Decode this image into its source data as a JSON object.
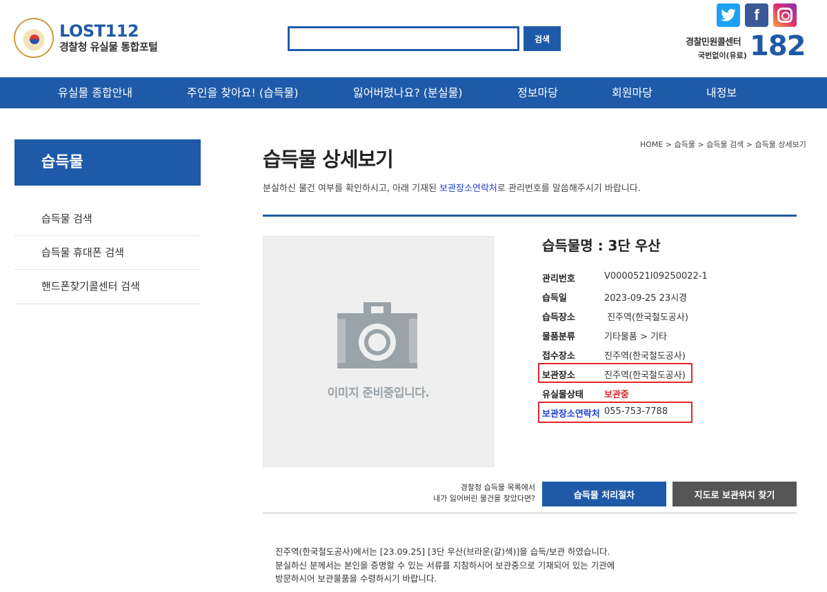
{
  "header": {
    "logo_main": "LOST112",
    "logo_sub": "경찰청 유실물 통합포털",
    "search_value": "",
    "search_button": "검색",
    "social": {
      "twitter_icon": "t",
      "facebook_icon": "f"
    },
    "callcenter_title": "경찰민원콜센터",
    "callcenter_sub": "국번없이(유료)",
    "callcenter_number": "182"
  },
  "nav": {
    "items": [
      {
        "label": "유실물 종합안내"
      },
      {
        "label": "주인을 찾아요! (습득물)"
      },
      {
        "label": "잃어버렸나요? (분실물)"
      },
      {
        "label": "정보마당"
      },
      {
        "label": "회원마당"
      },
      {
        "label": "내정보"
      }
    ]
  },
  "sidebar": {
    "title": "습득물",
    "items": [
      {
        "label": "습득물 검색"
      },
      {
        "label": "습득물 휴대폰 검색"
      },
      {
        "label": "핸드폰찾기콜센터 검색"
      }
    ]
  },
  "breadcrumb": {
    "items": [
      "HOME",
      "습득물",
      "습득물 검색",
      "습득물 상세보기"
    ],
    "separator": ">"
  },
  "page": {
    "title": "습득물 상세보기",
    "intro_before": "분실하신 물건 여부를 확인하시고, 아래 기재된 ",
    "intro_highlight": "보관장소연락처",
    "intro_after": "로 관리번호를 말씀해주시기 바랍니다.",
    "photo_placeholder": "이미지 준비중입니다."
  },
  "item": {
    "name": "습득물명 : 3단 우산",
    "fields": [
      {
        "label": "관리번호",
        "value": "V0000521I09250022-1"
      },
      {
        "label": "습득일",
        "value": "2023-09-25 23시경"
      },
      {
        "label": "습득장소",
        "value": " 진주역(한국철도공사)"
      },
      {
        "label": "물품분류",
        "value": "기타물품 > 기타"
      },
      {
        "label": "접수장소",
        "value": "진주역(한국철도공사)"
      },
      {
        "label": "보관장소",
        "value": "진주역(한국철도공사)"
      },
      {
        "label": "유실물상태",
        "value": "보관중"
      },
      {
        "label": "보관장소연락처",
        "value": "055-753-7788"
      }
    ],
    "status_color": "#e0262b",
    "contact_label_color": "#1f3fd0"
  },
  "actions": {
    "help_line1": "경찰청 습득물 목록에서",
    "help_line2": "내가 잃어버린 물건을 찾았다면?",
    "process_button": "습득물 처리절차",
    "map_button": "지도로 보관위치 찾기"
  },
  "description": {
    "lines": [
      "진주역(한국철도공사)에서는 [23.09.25] [3단 우산(브라운(갈)색)]을 습득/보관 하였습니다.",
      "분실하신 분께서는 본인을 증명할 수 있는 서류를 지참하시어 보관중으로 기재되어 있는 기관에",
      "방문하시어 보관물품을 수령하시기 바랍니다."
    ]
  },
  "colors": {
    "brand_blue": "#1f5aa8",
    "highlight_red": "#e0262b"
  }
}
